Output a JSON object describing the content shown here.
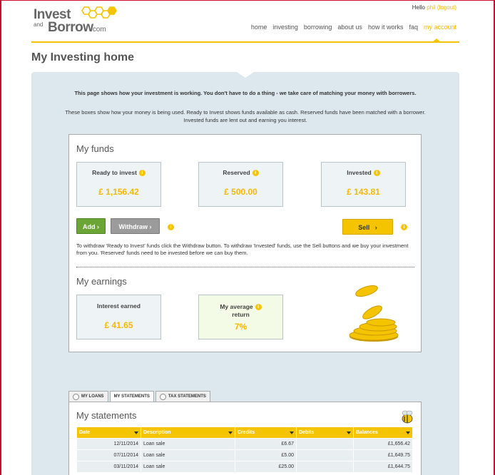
{
  "header": {
    "logo": {
      "word1": "Invest",
      "word2": "and",
      "word3": "Borrow",
      "word4": ".com"
    },
    "hello": "Hello",
    "user_name": "phil",
    "logout": "(logout)",
    "nav": [
      {
        "label": "home"
      },
      {
        "label": "investing"
      },
      {
        "label": "borrowing"
      },
      {
        "label": "about us"
      },
      {
        "label": "how it works"
      },
      {
        "label": "faq"
      },
      {
        "label": "my account",
        "active": true
      }
    ],
    "accent_color": "#f5c400"
  },
  "page": {
    "title": "My Investing home",
    "intro_bold": "This page shows how your investment is working. You don't have to do a thing - we take care of matching your money with borrowers.",
    "intro": "These boxes show how your money is being used. Ready to Invest shows funds available as cash. Reserved funds have been matched with a borrower. Invested funds are lent out and earning you interest."
  },
  "funds": {
    "title": "My funds",
    "ready": {
      "label": "Ready to invest",
      "value": "£ 1,156.42"
    },
    "reserved": {
      "label": "Reserved",
      "value": "£ 500.00"
    },
    "invested": {
      "label": "Invested",
      "value": "£ 143.81"
    },
    "add_label": "Add",
    "withdraw_label": "Withdraw",
    "sell_label": "Sell",
    "note": "To withdraw 'Ready to Invest' funds click the Withdraw button. To withdraw 'Invested' funds, use the Sell buttons and we buy your investment from you. 'Reserved' funds need to be invested before we can buy them."
  },
  "earnings": {
    "title": "My earnings",
    "interest": {
      "label": "Interest earned",
      "value": "£ 41.65"
    },
    "average": {
      "label_line1": "My average",
      "label_line2": "return",
      "value": "7%"
    }
  },
  "tabs": [
    {
      "label": "MY LOANS",
      "radio": true
    },
    {
      "label": "MY STATEMENTS",
      "active": true
    },
    {
      "label": "TAX STATEMENTS",
      "radio": true
    }
  ],
  "statements": {
    "title": "My statements",
    "columns": [
      "Date",
      "Description",
      "Credits",
      "Debits",
      "Balances"
    ],
    "rows": [
      {
        "date": "12/11/2014",
        "description": "Loan sale",
        "credit": "£6.67",
        "debit": "",
        "balance": "£1,656.42"
      },
      {
        "date": "07/11/2014",
        "description": "Loan sale",
        "credit": "£5.00",
        "debit": "",
        "balance": "£1,649.75"
      },
      {
        "date": "03/11/2014",
        "description": "Loan sale",
        "credit": "£25.00",
        "debit": "",
        "balance": "£1,644.75"
      }
    ]
  }
}
